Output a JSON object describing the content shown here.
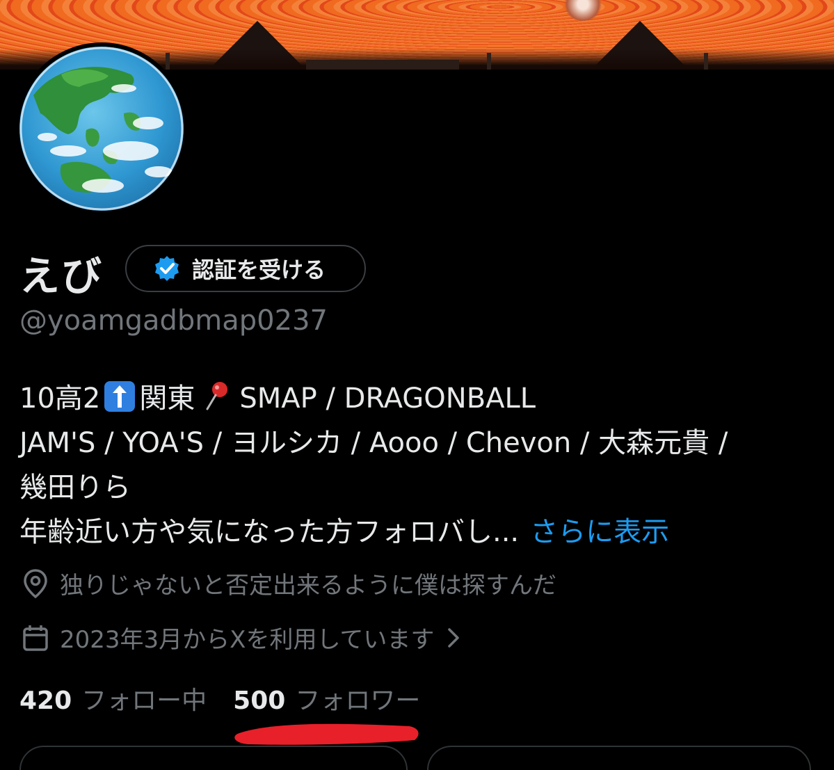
{
  "profile": {
    "display_name": "えび",
    "verify_button_label": "認証を受ける",
    "handle": "@yoamgadbmap0237",
    "bio": {
      "line1_pre": "10高2",
      "line1_mid": "関東",
      "line1_post": "SMAP / DRAGONBALL",
      "line2": "JAM'S / YOA'S / ヨルシカ / Aooo / Chevon / 大森元貴 /",
      "line3": "幾田りら",
      "line4": "年齢近い方や気になった方フォロバし...",
      "more_link": "さらに表示"
    },
    "location": "独りじゃないと否定出来るように僕は探すんだ",
    "joined": "2023年3月からXを利用しています",
    "following_count": "420",
    "following_label": "フォロー中",
    "followers_count": "500",
    "followers_label": "フォロワー"
  },
  "icons": {
    "verified_badge": "verified-badge-icon",
    "location": "location-pin-icon",
    "calendar": "calendar-icon",
    "chevron": "chevron-right-icon",
    "up_arrow_emoji": "up-arrow-emoji-icon",
    "pushpin_emoji": "round-pushpin-emoji-icon"
  },
  "colors": {
    "background": "#000000",
    "text_primary": "#e7e9ea",
    "text_secondary": "#71767b",
    "link": "#1d9bf0",
    "verified": "#1d9bf0",
    "annotation_mark": "#e8202a"
  }
}
